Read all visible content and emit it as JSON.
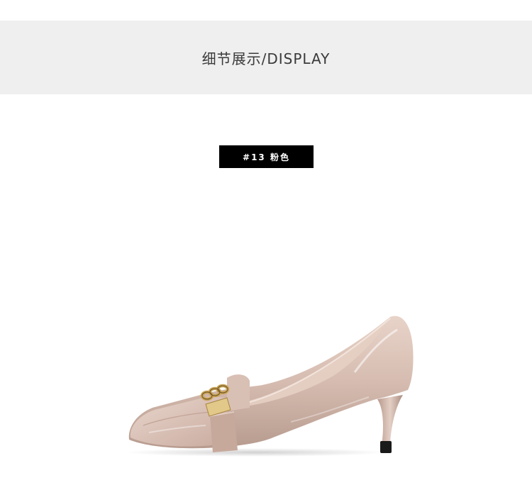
{
  "header": {
    "title": "细节展示/DISPLAY"
  },
  "product": {
    "color_tag": "#13 粉色",
    "image_icon": "pointed-toe-pump-shoe-icon",
    "colors": {
      "header_band": "#efefef",
      "tag_background": "#000000",
      "shoe_patent_nude": "#d9bfb4",
      "chain_gold": "#c9a457",
      "heel_tip": "#1a1a1a"
    }
  }
}
